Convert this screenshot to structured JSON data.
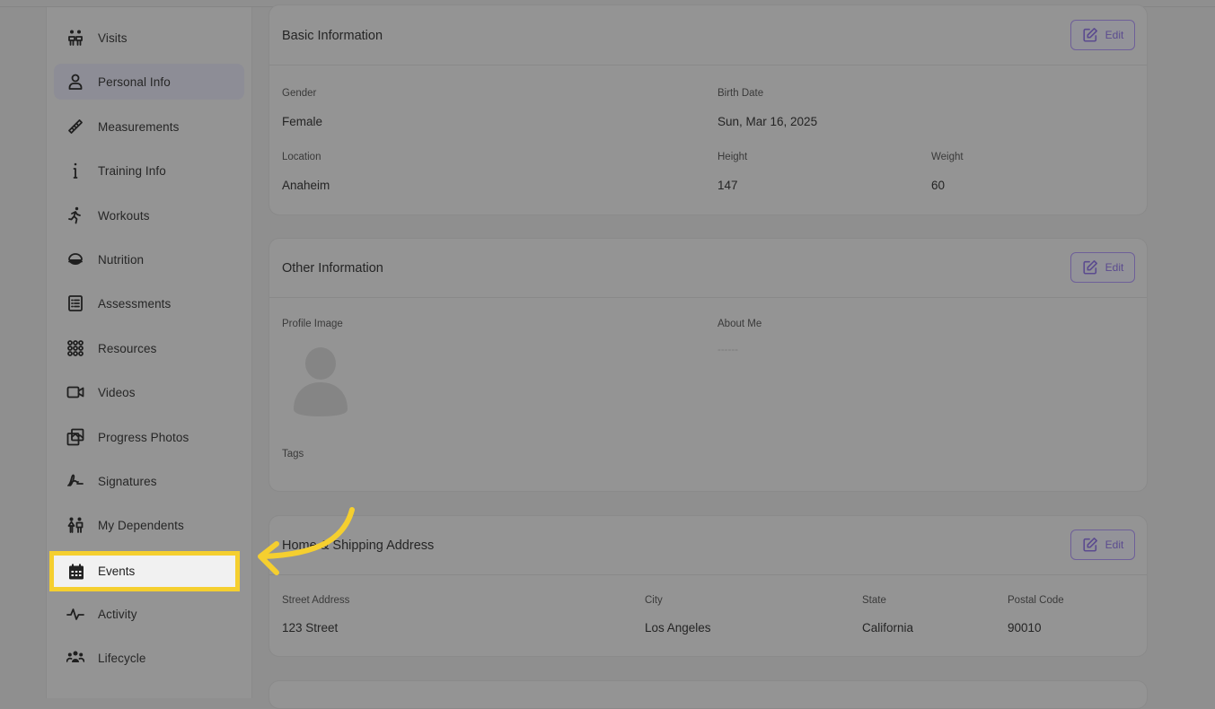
{
  "sidebar": {
    "items": [
      {
        "label": "Visits",
        "icon": "visits-icon"
      },
      {
        "label": "Personal Info",
        "icon": "person-icon",
        "active": true
      },
      {
        "label": "Measurements",
        "icon": "ruler-icon"
      },
      {
        "label": "Training Info",
        "icon": "info-icon"
      },
      {
        "label": "Workouts",
        "icon": "running-icon"
      },
      {
        "label": "Nutrition",
        "icon": "bowl-icon"
      },
      {
        "label": "Assessments",
        "icon": "checklist-icon"
      },
      {
        "label": "Resources",
        "icon": "grid-dots-icon"
      },
      {
        "label": "Videos",
        "icon": "video-icon"
      },
      {
        "label": "Progress Photos",
        "icon": "photos-icon"
      },
      {
        "label": "Signatures",
        "icon": "signature-icon"
      },
      {
        "label": "My Dependents",
        "icon": "dependents-icon"
      },
      {
        "label": "Events",
        "icon": "calendar-icon",
        "highlighted": true
      },
      {
        "label": "Activity",
        "icon": "activity-icon"
      },
      {
        "label": "Lifecycle",
        "icon": "group-icon"
      }
    ]
  },
  "basic_info": {
    "title": "Basic Information",
    "edit_label": "Edit",
    "gender_label": "Gender",
    "gender_value": "Female",
    "birth_label": "Birth Date",
    "birth_value": "Sun, Mar 16, 2025",
    "location_label": "Location",
    "location_value": "Anaheim",
    "height_label": "Height",
    "height_value": "147",
    "weight_label": "Weight",
    "weight_value": "60"
  },
  "other_info": {
    "title": "Other Information",
    "edit_label": "Edit",
    "profile_image_label": "Profile Image",
    "about_label": "About Me",
    "about_value": "------",
    "tags_label": "Tags"
  },
  "address": {
    "title": "Home & Shipping Address",
    "edit_label": "Edit",
    "street_label": "Street Address",
    "street_value": "123 Street",
    "city_label": "City",
    "city_value": "Los Angeles",
    "state_label": "State",
    "state_value": "California",
    "postal_label": "Postal Code",
    "postal_value": "90010"
  },
  "colors": {
    "highlight": "#f5cf2f",
    "accent": "#5b4b8f"
  }
}
